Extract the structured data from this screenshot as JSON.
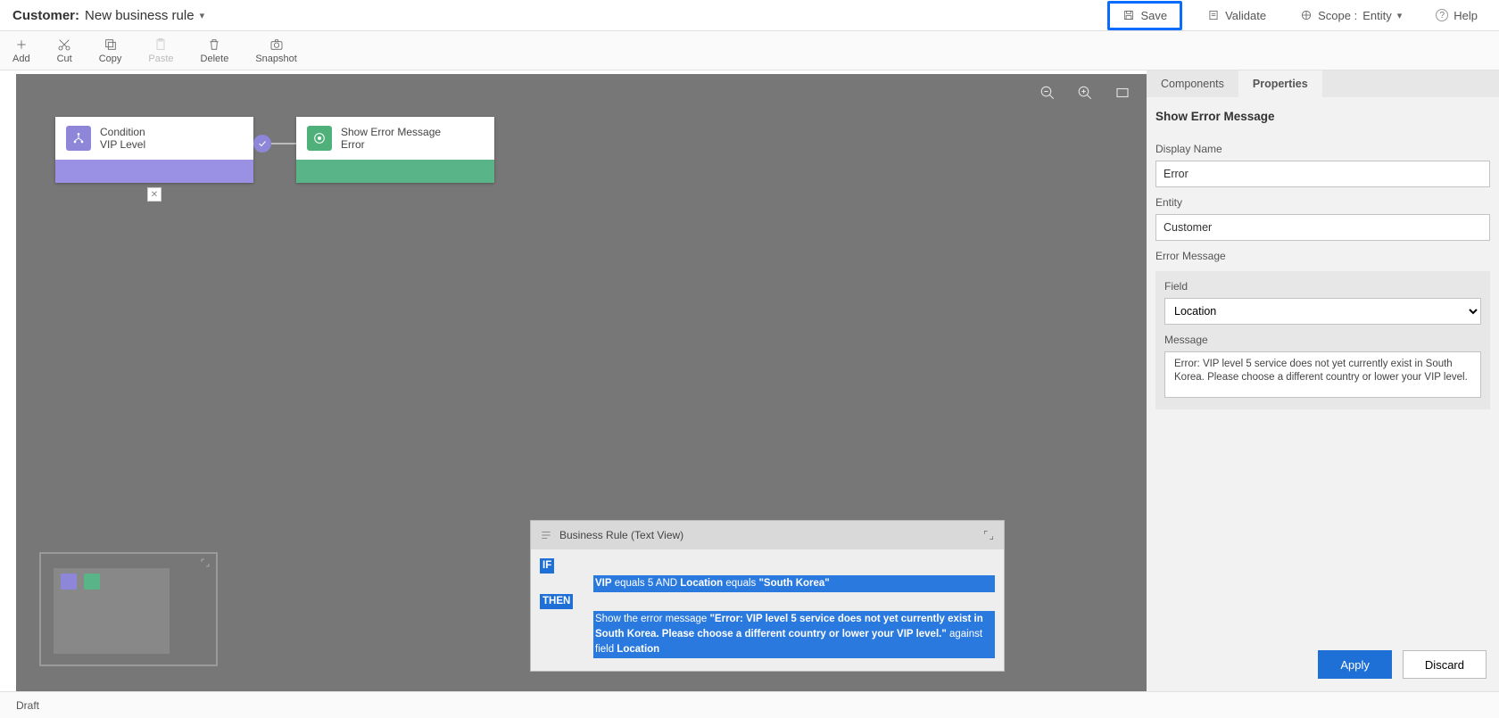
{
  "header": {
    "entity_prefix": "Customer:",
    "rule_name": "New business rule",
    "save": "Save",
    "validate": "Validate",
    "scope_label": "Scope :",
    "scope_value": "Entity",
    "help": "Help"
  },
  "ribbon": {
    "add": "Add",
    "cut": "Cut",
    "copy": "Copy",
    "paste": "Paste",
    "delete": "Delete",
    "snapshot": "Snapshot"
  },
  "flow": {
    "condition": {
      "title": "Condition",
      "sub": "VIP Level"
    },
    "error": {
      "title": "Show Error Message",
      "sub": "Error"
    }
  },
  "textview": {
    "title": "Business Rule (Text View)",
    "if": "IF",
    "then": "THEN",
    "cond_line_pre": "VIP",
    "cond_eq1": " equals 5 AND ",
    "cond_loc": "Location",
    "cond_eq2": " equals ",
    "cond_val": "\"South Korea\"",
    "then_pre": "Show the error message ",
    "then_msg": "\"Error: VIP level 5 service does not yet currently exist in South Korea. Please choose a different country or lower your VIP level.\"",
    "then_post": " against field ",
    "then_field": "Location"
  },
  "panel": {
    "tab_components": "Components",
    "tab_properties": "Properties",
    "section": "Show Error Message",
    "display_name_label": "Display Name",
    "display_name_value": "Error",
    "entity_label": "Entity",
    "entity_value": "Customer",
    "error_message_label": "Error Message",
    "field_label": "Field",
    "field_value": "Location",
    "message_label": "Message",
    "message_value": "Error: VIP level 5 service does not yet currently exist in South Korea. Please choose a different country or lower your VIP level.",
    "apply": "Apply",
    "discard": "Discard"
  },
  "footer": {
    "status": "Draft"
  }
}
